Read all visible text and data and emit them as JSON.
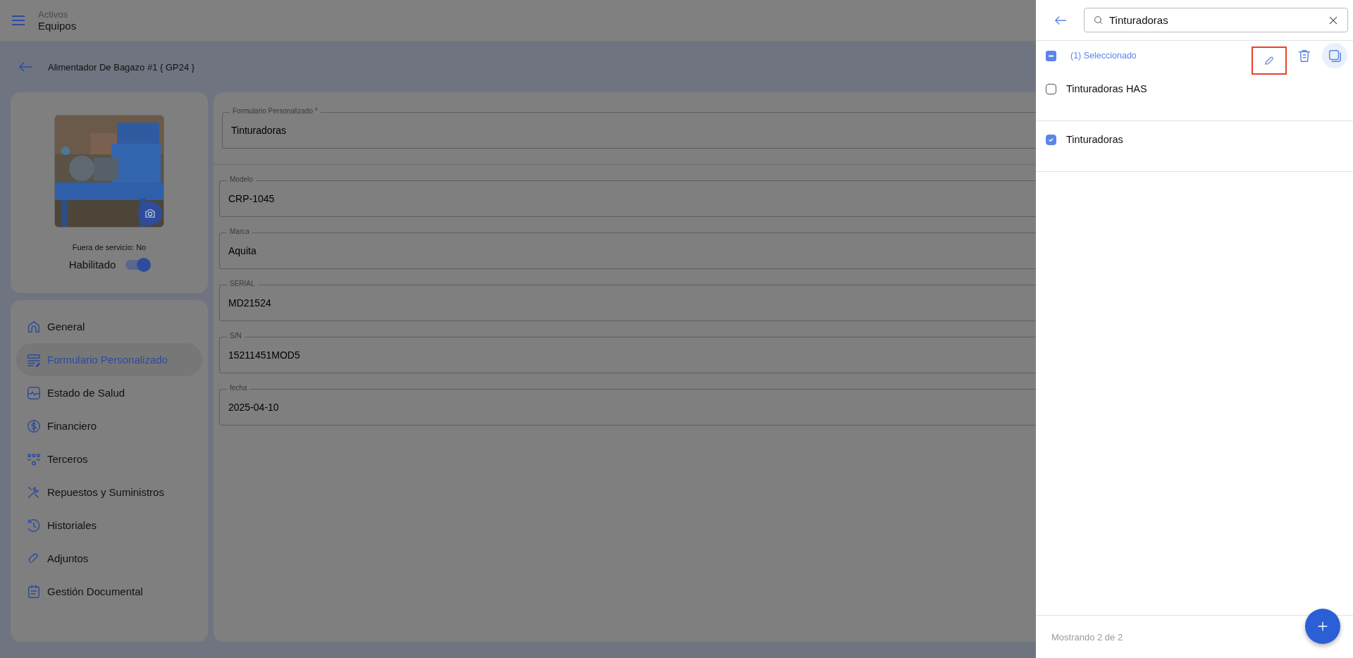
{
  "header": {
    "section": "Activos",
    "title": "Equipos"
  },
  "breadcrumb": {
    "title": "Alimentador De Bagazo #1 { GP24 }"
  },
  "asset": {
    "out_of_service": "Fuera de servicio: No",
    "enabled_label": "Habilitado",
    "enabled": true
  },
  "nav": [
    {
      "label": "General",
      "selected": false
    },
    {
      "label": "Formulario Personalizado",
      "selected": true
    },
    {
      "label": "Estado de Salud",
      "selected": false
    },
    {
      "label": "Financiero",
      "selected": false
    },
    {
      "label": "Terceros",
      "selected": false
    },
    {
      "label": "Repuestos y Suministros",
      "selected": false
    },
    {
      "label": "Historiales",
      "selected": false
    },
    {
      "label": "Adjuntos",
      "selected": false
    },
    {
      "label": "Gestión Documental",
      "selected": false
    }
  ],
  "form": {
    "selector": {
      "label": "Formulario Personalizado *",
      "value": "Tinturadoras"
    },
    "fields": [
      {
        "label": "Modelo",
        "value": "CRP-1045"
      },
      {
        "label": "Marca",
        "value": "Aquita"
      },
      {
        "label": "SERIAL",
        "value": "MD21524"
      },
      {
        "label": "S/N",
        "value": "15211451MOD5"
      },
      {
        "label": "fecha",
        "value": "2025-04-10"
      }
    ]
  },
  "drawer": {
    "search": {
      "value": "Tinturadoras"
    },
    "selection": {
      "label": "(1) Seleccionado",
      "edit_highlighted": true
    },
    "items": [
      {
        "label": "Tinturadoras HAS",
        "checked": false
      },
      {
        "label": "Tinturadoras",
        "checked": true
      }
    ],
    "footer": "Mostrando 2 de 2"
  }
}
